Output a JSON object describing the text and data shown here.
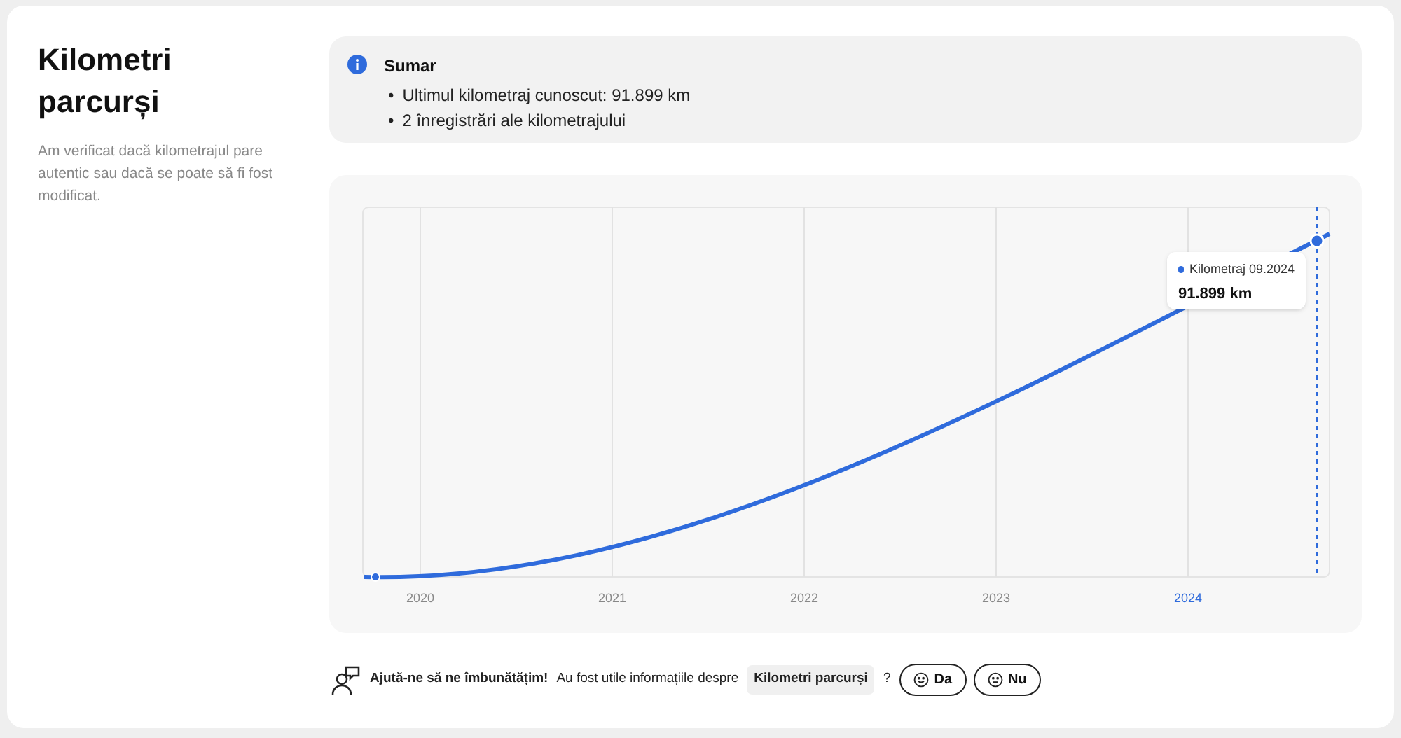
{
  "section": {
    "title": "Kilometri parcurși",
    "description": "Am verificat dacă kilometrajul pare autentic sau dacă se poate să fi fost modificat."
  },
  "summary": {
    "title": "Sumar",
    "items": [
      {
        "bullet": "•",
        "text": "Ultimul kilometraj cunoscut: 91.899 km"
      },
      {
        "bullet": "•",
        "text": "2 înregistrări ale kilometrajului"
      }
    ]
  },
  "chart": {
    "x_labels": [
      {
        "label": "2020",
        "selected": false
      },
      {
        "label": "2021",
        "selected": false
      },
      {
        "label": "2022",
        "selected": false
      },
      {
        "label": "2023",
        "selected": false
      },
      {
        "label": "2024",
        "selected": true
      }
    ],
    "tooltip": {
      "label": "Kilometraj 09.2024",
      "value": "91.899 km"
    }
  },
  "feedback": {
    "prompt": "Ajută-ne să ne îmbunătățim!",
    "question": "Au fost utile informațiile despre",
    "topic": "Kilometri parcurși",
    "question_mark": "?",
    "buttons": [
      {
        "label": "Da",
        "kind": "happy"
      },
      {
        "label": "Nu",
        "kind": "neutral"
      }
    ]
  }
}
